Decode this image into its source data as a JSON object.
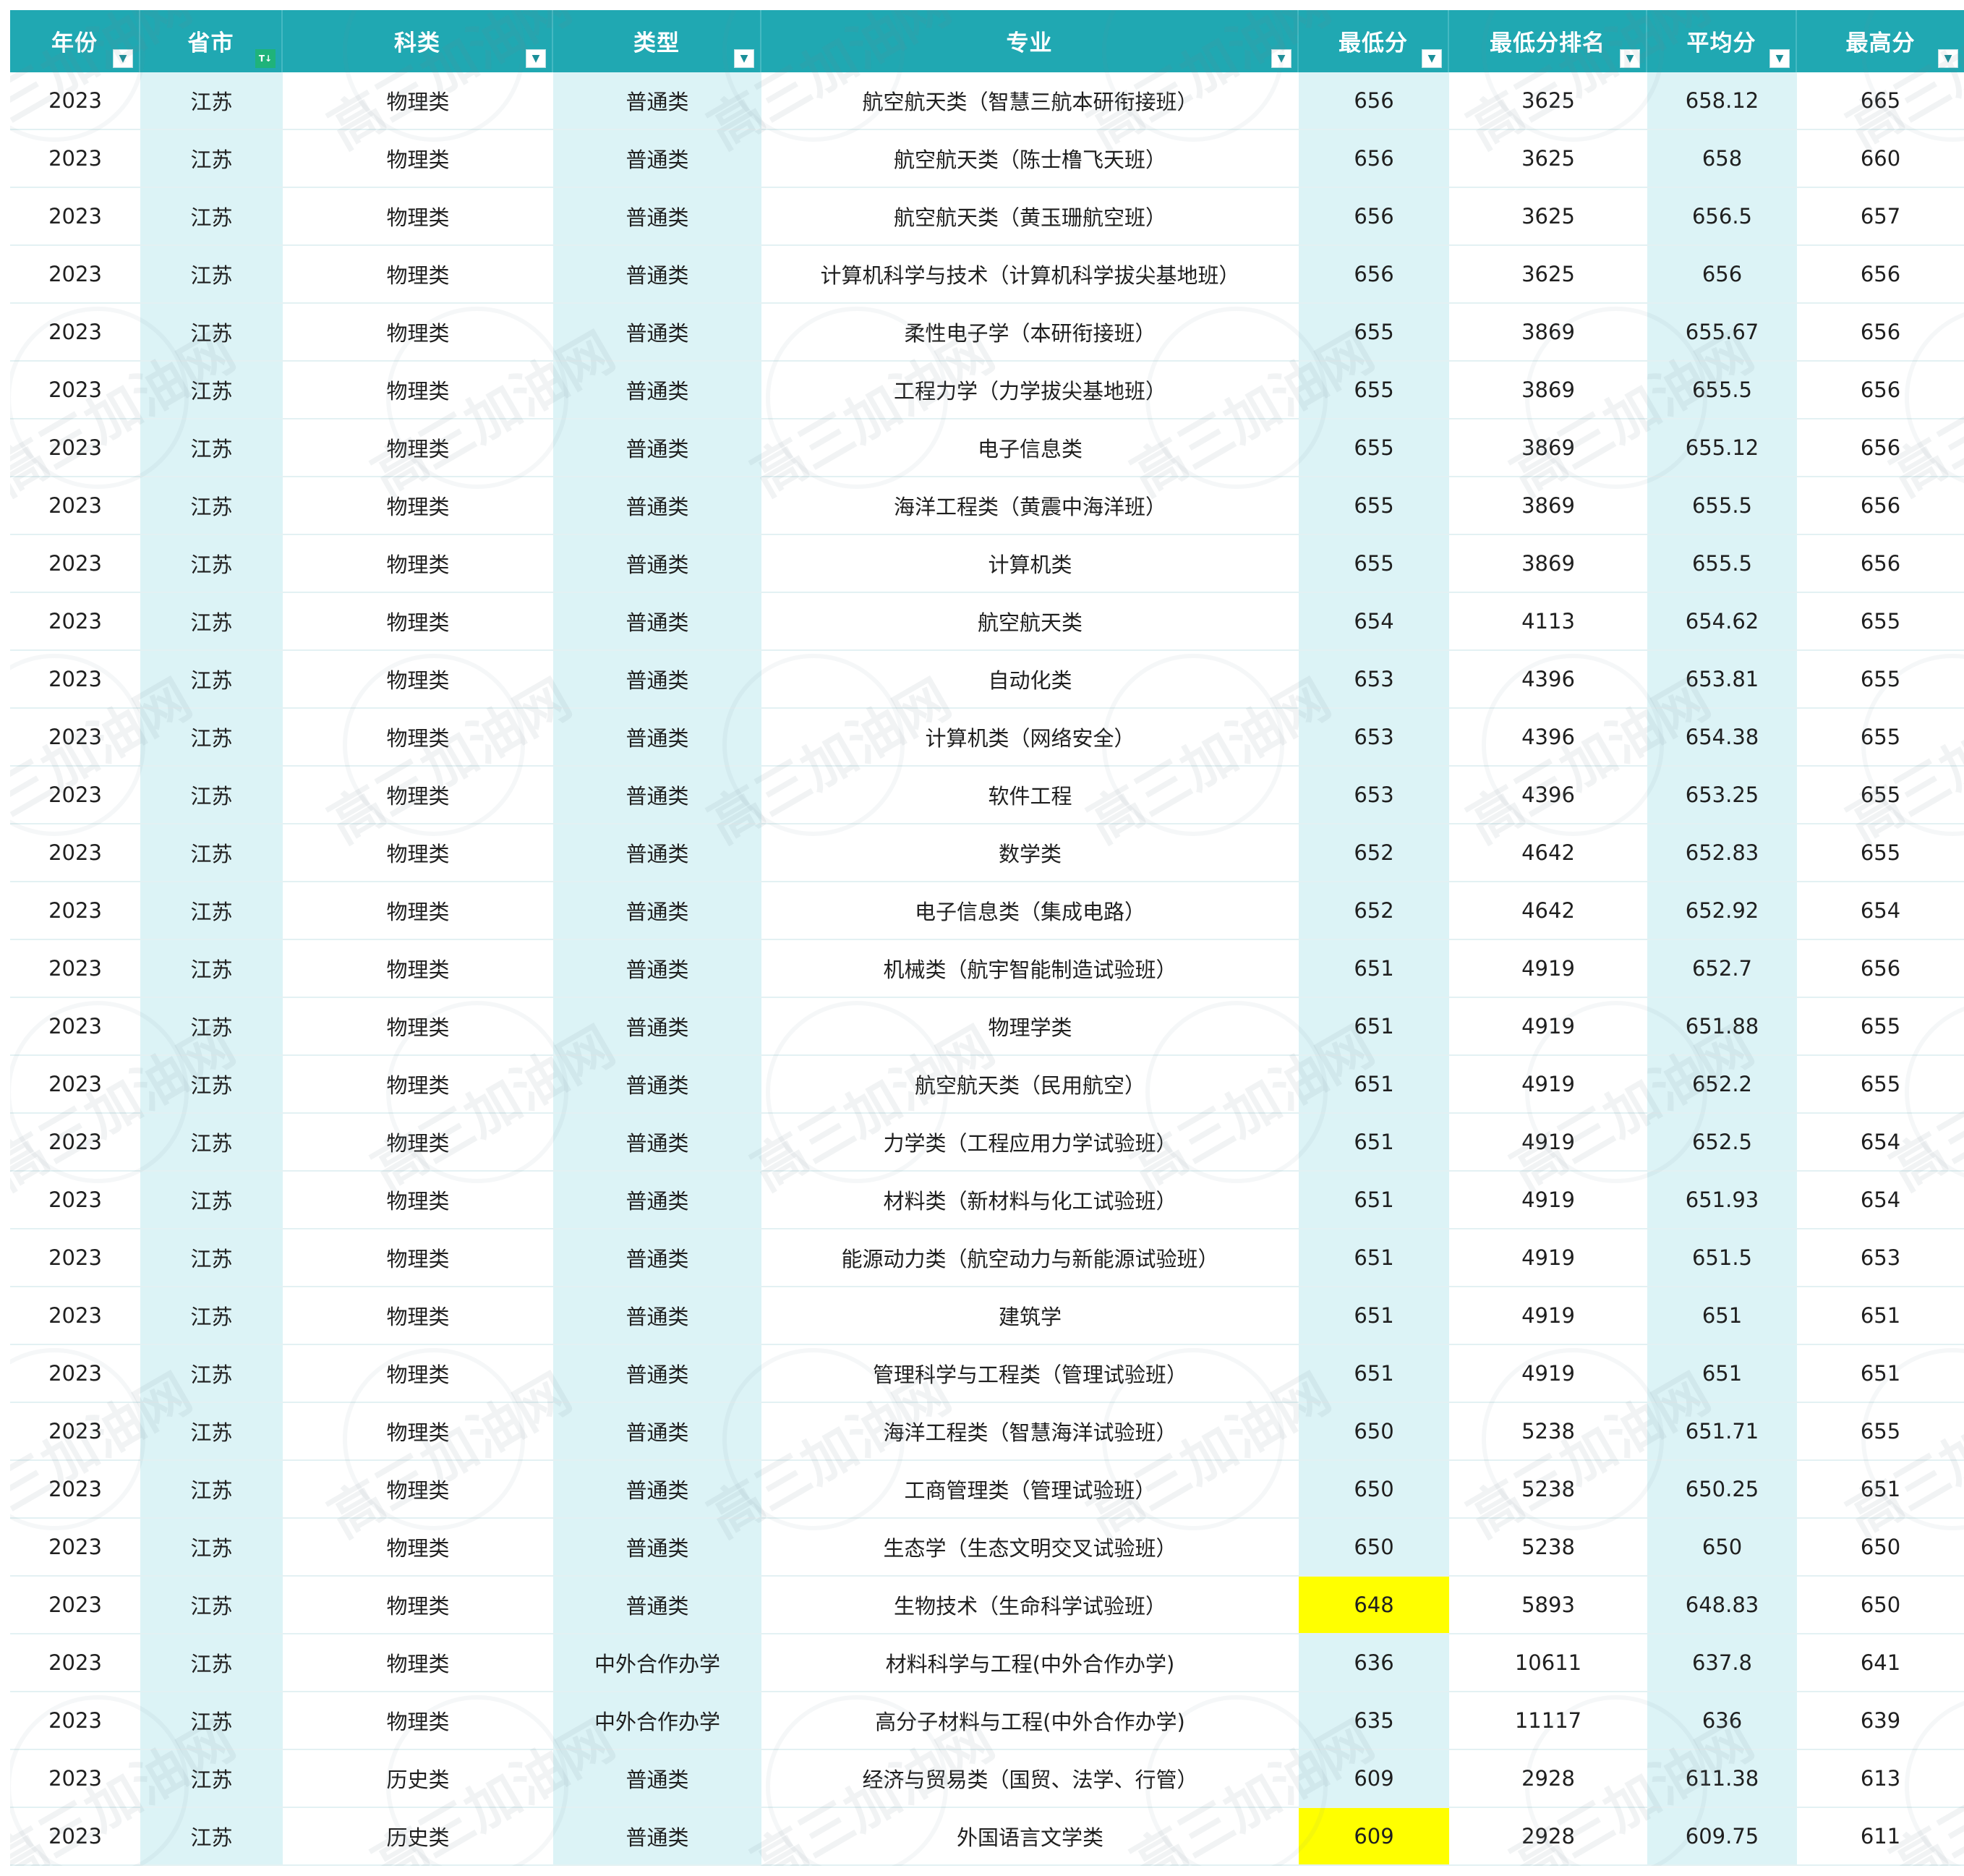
{
  "headers": [
    {
      "label": "年份",
      "filter": "filter"
    },
    {
      "label": "省市",
      "filter": "sorted"
    },
    {
      "label": "科类",
      "filter": "filter"
    },
    {
      "label": "类型",
      "filter": "filter"
    },
    {
      "label": "专业",
      "filter": "filter"
    },
    {
      "label": "最低分",
      "filter": "filter"
    },
    {
      "label": "最低分排名",
      "filter": "filter"
    },
    {
      "label": "平均分",
      "filter": "filter"
    },
    {
      "label": "最高分",
      "filter": "filter"
    }
  ],
  "filter_glyph": "▼",
  "sorted_glyph": "T↓",
  "watermark_text": "高三加油网",
  "highlight_color": "#ffff00",
  "accent_color": "#20a8b2",
  "rows": [
    [
      "2023",
      "江苏",
      "物理类",
      "普通类",
      "航空航天类（智慧三航本研衔接班）",
      "656",
      "3625",
      "658.12",
      "665"
    ],
    [
      "2023",
      "江苏",
      "物理类",
      "普通类",
      "航空航天类（陈士橹飞天班）",
      "656",
      "3625",
      "658",
      "660"
    ],
    [
      "2023",
      "江苏",
      "物理类",
      "普通类",
      "航空航天类（黄玉珊航空班）",
      "656",
      "3625",
      "656.5",
      "657"
    ],
    [
      "2023",
      "江苏",
      "物理类",
      "普通类",
      "计算机科学与技术（计算机科学拔尖基地班）",
      "656",
      "3625",
      "656",
      "656"
    ],
    [
      "2023",
      "江苏",
      "物理类",
      "普通类",
      "柔性电子学（本研衔接班）",
      "655",
      "3869",
      "655.67",
      "656"
    ],
    [
      "2023",
      "江苏",
      "物理类",
      "普通类",
      "工程力学（力学拔尖基地班）",
      "655",
      "3869",
      "655.5",
      "656"
    ],
    [
      "2023",
      "江苏",
      "物理类",
      "普通类",
      "电子信息类",
      "655",
      "3869",
      "655.12",
      "656"
    ],
    [
      "2023",
      "江苏",
      "物理类",
      "普通类",
      "海洋工程类（黄震中海洋班）",
      "655",
      "3869",
      "655.5",
      "656"
    ],
    [
      "2023",
      "江苏",
      "物理类",
      "普通类",
      "计算机类",
      "655",
      "3869",
      "655.5",
      "656"
    ],
    [
      "2023",
      "江苏",
      "物理类",
      "普通类",
      "航空航天类",
      "654",
      "4113",
      "654.62",
      "655"
    ],
    [
      "2023",
      "江苏",
      "物理类",
      "普通类",
      "自动化类",
      "653",
      "4396",
      "653.81",
      "655"
    ],
    [
      "2023",
      "江苏",
      "物理类",
      "普通类",
      "计算机类（网络安全）",
      "653",
      "4396",
      "654.38",
      "655"
    ],
    [
      "2023",
      "江苏",
      "物理类",
      "普通类",
      "软件工程",
      "653",
      "4396",
      "653.25",
      "655"
    ],
    [
      "2023",
      "江苏",
      "物理类",
      "普通类",
      "数学类",
      "652",
      "4642",
      "652.83",
      "655"
    ],
    [
      "2023",
      "江苏",
      "物理类",
      "普通类",
      "电子信息类（集成电路）",
      "652",
      "4642",
      "652.92",
      "654"
    ],
    [
      "2023",
      "江苏",
      "物理类",
      "普通类",
      "机械类（航宇智能制造试验班）",
      "651",
      "4919",
      "652.7",
      "656"
    ],
    [
      "2023",
      "江苏",
      "物理类",
      "普通类",
      "物理学类",
      "651",
      "4919",
      "651.88",
      "655"
    ],
    [
      "2023",
      "江苏",
      "物理类",
      "普通类",
      "航空航天类（民用航空）",
      "651",
      "4919",
      "652.2",
      "655"
    ],
    [
      "2023",
      "江苏",
      "物理类",
      "普通类",
      "力学类（工程应用力学试验班）",
      "651",
      "4919",
      "652.5",
      "654"
    ],
    [
      "2023",
      "江苏",
      "物理类",
      "普通类",
      "材料类（新材料与化工试验班）",
      "651",
      "4919",
      "651.93",
      "654"
    ],
    [
      "2023",
      "江苏",
      "物理类",
      "普通类",
      "能源动力类（航空动力与新能源试验班）",
      "651",
      "4919",
      "651.5",
      "653"
    ],
    [
      "2023",
      "江苏",
      "物理类",
      "普通类",
      "建筑学",
      "651",
      "4919",
      "651",
      "651"
    ],
    [
      "2023",
      "江苏",
      "物理类",
      "普通类",
      "管理科学与工程类（管理试验班）",
      "651",
      "4919",
      "651",
      "651"
    ],
    [
      "2023",
      "江苏",
      "物理类",
      "普通类",
      "海洋工程类（智慧海洋试验班）",
      "650",
      "5238",
      "651.71",
      "655"
    ],
    [
      "2023",
      "江苏",
      "物理类",
      "普通类",
      "工商管理类（管理试验班）",
      "650",
      "5238",
      "650.25",
      "651"
    ],
    [
      "2023",
      "江苏",
      "物理类",
      "普通类",
      "生态学（生态文明交叉试验班）",
      "650",
      "5238",
      "650",
      "650"
    ],
    [
      "2023",
      "江苏",
      "物理类",
      "普通类",
      "生物技术（生命科学试验班）",
      "648",
      "5893",
      "648.83",
      "650"
    ],
    [
      "2023",
      "江苏",
      "物理类",
      "中外合作办学",
      "材料科学与工程(中外合作办学)",
      "636",
      "10611",
      "637.8",
      "641"
    ],
    [
      "2023",
      "江苏",
      "物理类",
      "中外合作办学",
      "高分子材料与工程(中外合作办学)",
      "635",
      "11117",
      "636",
      "639"
    ],
    [
      "2023",
      "江苏",
      "历史类",
      "普通类",
      "经济与贸易类（国贸、法学、行管）",
      "609",
      "2928",
      "611.38",
      "613"
    ],
    [
      "2023",
      "江苏",
      "历史类",
      "普通类",
      "外国语言文学类",
      "609",
      "2928",
      "609.75",
      "611"
    ]
  ],
  "highlighted_min_score_rows": [
    26,
    30
  ]
}
